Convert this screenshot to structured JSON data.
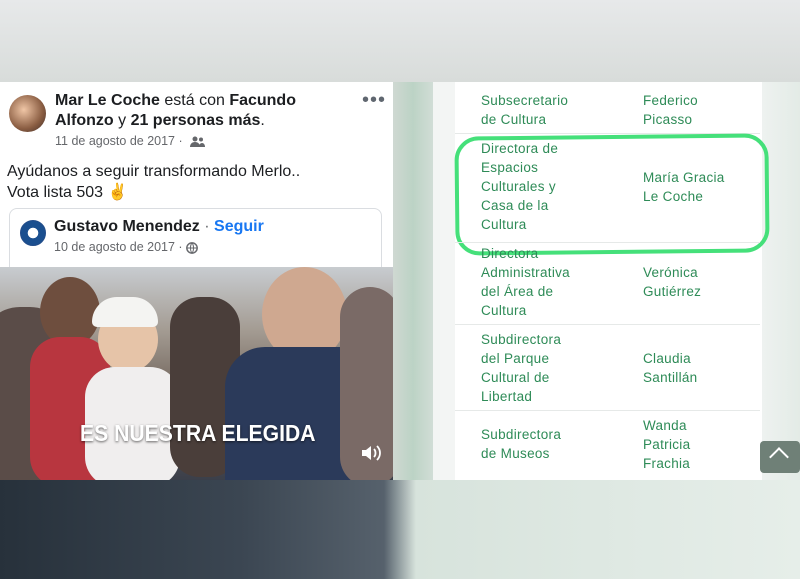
{
  "facebook_post": {
    "author": "Mar Le Coche",
    "with_text": "está con",
    "tagged": "Facundo Alfonzo",
    "and_text": "y",
    "others": "21 personas más",
    "date": "11 de agosto de 2017",
    "text_line1": "Ayúdanos a seguir transformando Merlo..",
    "text_line2": "Vota lista 503",
    "emoji": "✌",
    "shared": {
      "name": "Gustavo Menendez",
      "follow": "Seguir",
      "date": "10 de agosto de 2017"
    },
    "video_caption": "ES NUESTRA ELEGIDA"
  },
  "table": {
    "rows": [
      {
        "role": [
          "Subsecretario",
          "de Cultura"
        ],
        "name": [
          "Federico",
          "Picasso"
        ]
      },
      {
        "role": [
          "Directora de",
          "Espacios",
          "Culturales y",
          "Casa de la",
          "Cultura"
        ],
        "name": [
          "María Gracia",
          "Le Coche"
        ]
      },
      {
        "role": [
          "Directora",
          "Administrativa",
          "del Área de",
          "Cultura"
        ],
        "name": [
          "Verónica",
          "Gutiérrez"
        ]
      },
      {
        "role": [
          "Subdirectora",
          "del Parque",
          "Cultural de",
          "Libertad"
        ],
        "name": [
          "Claudia",
          "Santillán"
        ]
      },
      {
        "role": [
          "Subdirectora",
          "de Museos"
        ],
        "name": [
          "Wanda",
          "Patricia",
          "Frachia"
        ]
      }
    ]
  },
  "colors": {
    "table_text": "#2e8b57",
    "highlight": "#45e07a",
    "fb_link": "#1877f2"
  }
}
